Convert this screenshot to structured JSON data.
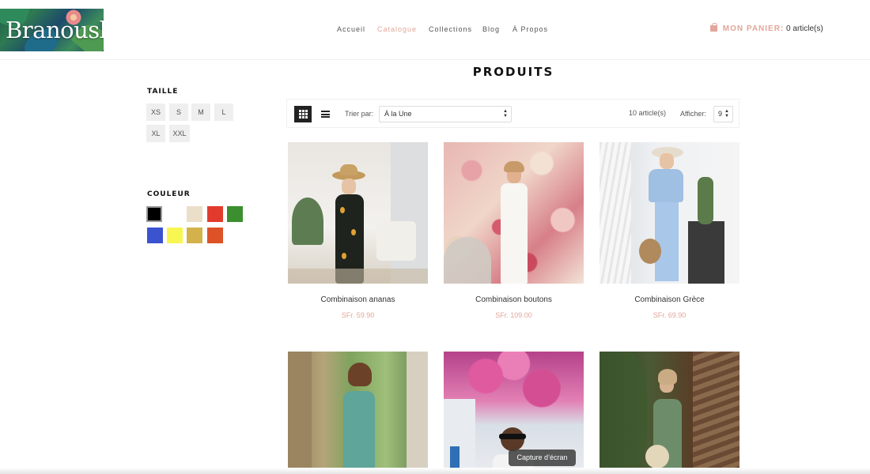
{
  "header": {
    "logo_text": "Branousli",
    "nav": [
      {
        "label": "Accueil",
        "active": false
      },
      {
        "label": "Catalogue",
        "active": true
      },
      {
        "label": "Collections",
        "active": false
      },
      {
        "label": "Blog",
        "active": false
      },
      {
        "label": "À Propos",
        "active": false
      }
    ],
    "cart_label": "MON PANIER:",
    "cart_count": "0 article(s)",
    "accent_color": "#e2a69a"
  },
  "page_title": "PRODUITS",
  "filters": {
    "size_title": "TAILLE",
    "sizes": [
      "XS",
      "S",
      "M",
      "L",
      "XL",
      "XXL"
    ],
    "color_title": "COULEUR",
    "colors": [
      "#000000",
      "#ffffff",
      "#ebdfc9",
      "#e23b2e",
      "#3b8f2e",
      "#3b53cf",
      "#f8f650",
      "#d3b24c",
      "#dd5226"
    ]
  },
  "toolbar": {
    "sort_label": "Trier par:",
    "sort_value": "À la Une",
    "count": "10 article(s)",
    "show_label": "Afficher:",
    "show_value": "9"
  },
  "products": [
    {
      "name": "Combinaison ananas",
      "price": "SFr. 59.90"
    },
    {
      "name": "Combinaison boutons",
      "price": "SFr. 109.00"
    },
    {
      "name": "Combinaison Grèce",
      "price": "SFr. 69.90"
    },
    {
      "name": "",
      "price": ""
    },
    {
      "name": "",
      "price": ""
    },
    {
      "name": "",
      "price": ""
    }
  ],
  "tooltip": "Capture d’écran"
}
